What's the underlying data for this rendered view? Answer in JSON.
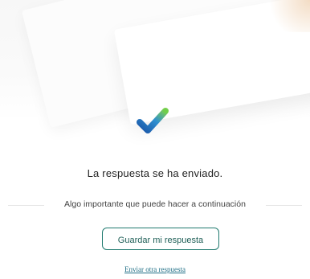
{
  "confirmation": {
    "title": "La respuesta se ha enviado.",
    "subtitle": "Algo importante que puede hacer a continuación",
    "save_button_label": "Guardar mi respuesta",
    "another_response_link": "Enviar otra respuesta"
  },
  "icons": {
    "success": "checkmark-icon"
  },
  "colors": {
    "accent": "#1f7a6f",
    "link": "#1f6f86",
    "check_blue": "#1f63b5",
    "check_green": "#5fbf4a"
  }
}
